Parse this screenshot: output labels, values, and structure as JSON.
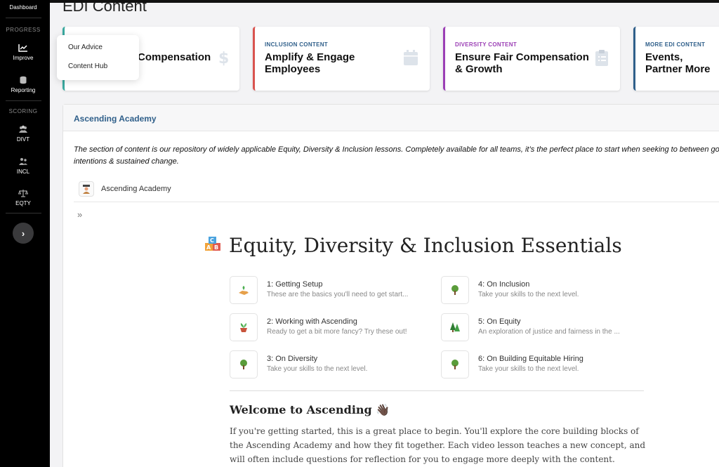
{
  "sidebar": {
    "top_item": "Dashboard",
    "progress_label": "PROGRESS",
    "improve": "Improve",
    "reporting": "Reporting",
    "scoring_label": "SCORING",
    "divt": "DIVT",
    "incl": "INCL",
    "eqty": "EQTY",
    "collapse_glyph": "›"
  },
  "page": {
    "title": "EDI Content"
  },
  "cards": [
    {
      "kicker": "",
      "title": "Compensation",
      "color": "#3aa99f"
    },
    {
      "kicker": "INCLUSION CONTENT",
      "title": "Amplify & Engage Employees",
      "color": "#d9534f"
    },
    {
      "kicker": "DIVERSITY CONTENT",
      "title": "Ensure Fair Compensation & Growth",
      "color": "#9b3fb5"
    },
    {
      "kicker": "MORE EDI CONTENT",
      "title": "Events, Partner More",
      "color": "#2f5f8a"
    }
  ],
  "popup": {
    "item1": "Our Advice",
    "item2": "Content Hub"
  },
  "panel": {
    "header": "Ascending Academy",
    "description": "The section of content is our repository of widely applicable Equity, Diversity & Inclusion lessons. Completely available for all teams, it’s the perfect place to start when seeking to between good intentions & sustained change.",
    "tab_label": "Ascending Academy",
    "expand_glyph": "»"
  },
  "doc": {
    "title": "Equity, Diversity & Inclusion Essentials",
    "tiles": [
      {
        "title": "1: Getting Setup",
        "subtitle": "These are the basics you'll need to get start...",
        "icon": "hand-plant-icon"
      },
      {
        "title": "2: Working with Ascending",
        "subtitle": "Ready to get a bit more fancy? Try these out!",
        "icon": "potted-plant-icon"
      },
      {
        "title": "3: On Diversity",
        "subtitle": "Take your skills to the next level.",
        "icon": "tree-icon"
      },
      {
        "title": "4: On Inclusion",
        "subtitle": "Take your skills to the next level.",
        "icon": "tree-icon"
      },
      {
        "title": "5: On Equity",
        "subtitle": "An exploration of justice and fairness in the ...",
        "icon": "pine-trees-icon"
      },
      {
        "title": "6: On Building Equitable Hiring",
        "subtitle": "Take your skills to the next level.",
        "icon": "tree-icon"
      }
    ],
    "welcome": "Welcome to Ascending 👋🏿",
    "paragraph": "If you're getting started, this is a great place to begin. You'll explore the core building blocks of the Ascending Academy and how they fit together. Each video lesson teaches a new concept, and will often include questions for reflection for you to engage more deeply with the content."
  }
}
